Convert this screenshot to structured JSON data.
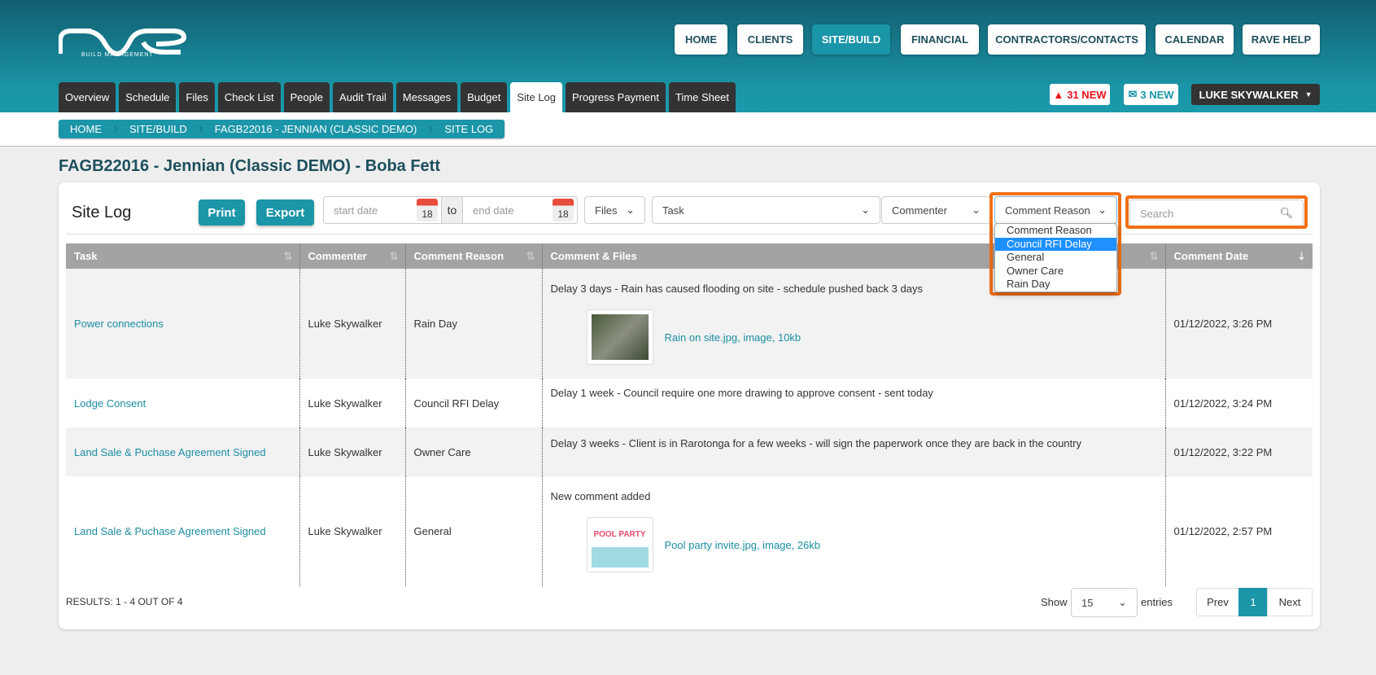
{
  "logo": {
    "text": "rave",
    "subtitle": "BUILD MANAGEMENT"
  },
  "nav": [
    "HOME",
    "CLIENTS",
    "SITE/BUILD",
    "FINANCIAL",
    "CONTRACTORS/CONTACTS",
    "CALENDAR",
    "RAVE HELP"
  ],
  "tabs": [
    "Overview",
    "Schedule",
    "Files",
    "Check List",
    "People",
    "Audit Trail",
    "Messages",
    "Budget",
    "Site Log",
    "Progress Payment",
    "Time Sheet"
  ],
  "alerts": {
    "warnings": "31 NEW",
    "messages": "3 NEW",
    "user": "LUKE SKYWALKER"
  },
  "breadcrumb": [
    "HOME",
    "SITE/BUILD",
    "FAGB22016 - JENNIAN (CLASSIC DEMO)",
    "SITE LOG"
  ],
  "page_title": "FAGB22016 - Jennian (Classic DEMO) - Boba Fett",
  "toolbar": {
    "title": "Site Log",
    "print": "Print",
    "export": "Export",
    "start_placeholder": "start date",
    "to": "to",
    "end_placeholder": "end date",
    "cal_day": "18",
    "files": "Files",
    "task": "Task",
    "commenter": "Commenter",
    "reason": "Comment Reason",
    "search_placeholder": "Search"
  },
  "reason_options": [
    "Comment Reason",
    "Council RFI Delay",
    "General",
    "Owner Care",
    "Rain Day"
  ],
  "columns": [
    "Task",
    "Commenter",
    "Comment Reason",
    "Comment & Files",
    "Comment Date"
  ],
  "rows": [
    {
      "task": "Power connections",
      "commenter": "Luke Skywalker",
      "reason": "Rain Day",
      "comment": "Delay 3 days - Rain has caused flooding on site - schedule pushed back 3 days",
      "file": "Rain on site.jpg, image, 10kb",
      "date": "01/12/2022, 3:26 PM"
    },
    {
      "task": "Lodge Consent",
      "commenter": "Luke Skywalker",
      "reason": "Council RFI Delay",
      "comment": "Delay 1 week - Council require one more drawing to approve consent - sent today",
      "date": "01/12/2022, 3:24 PM"
    },
    {
      "task": "Land Sale & Puchase Agreement Signed",
      "commenter": "Luke Skywalker",
      "reason": "Owner Care",
      "comment": "Delay 3 weeks - Client is in Rarotonga for a few weeks - will sign the paperwork once they are back in the country",
      "date": "01/12/2022, 3:22 PM"
    },
    {
      "task": "Land Sale & Puchase Agreement Signed",
      "commenter": "Luke Skywalker",
      "reason": "General",
      "comment": "New comment added",
      "file": "Pool party invite.jpg, image, 26kb",
      "date": "01/12/2022, 2:57 PM",
      "thumb_text": "POOL PARTY"
    }
  ],
  "footer": {
    "results": "RESULTS: 1 - 4 OUT OF 4",
    "show": "Show",
    "page_size": "15",
    "entries": "entries",
    "prev": "Prev",
    "page": "1",
    "next": "Next"
  }
}
